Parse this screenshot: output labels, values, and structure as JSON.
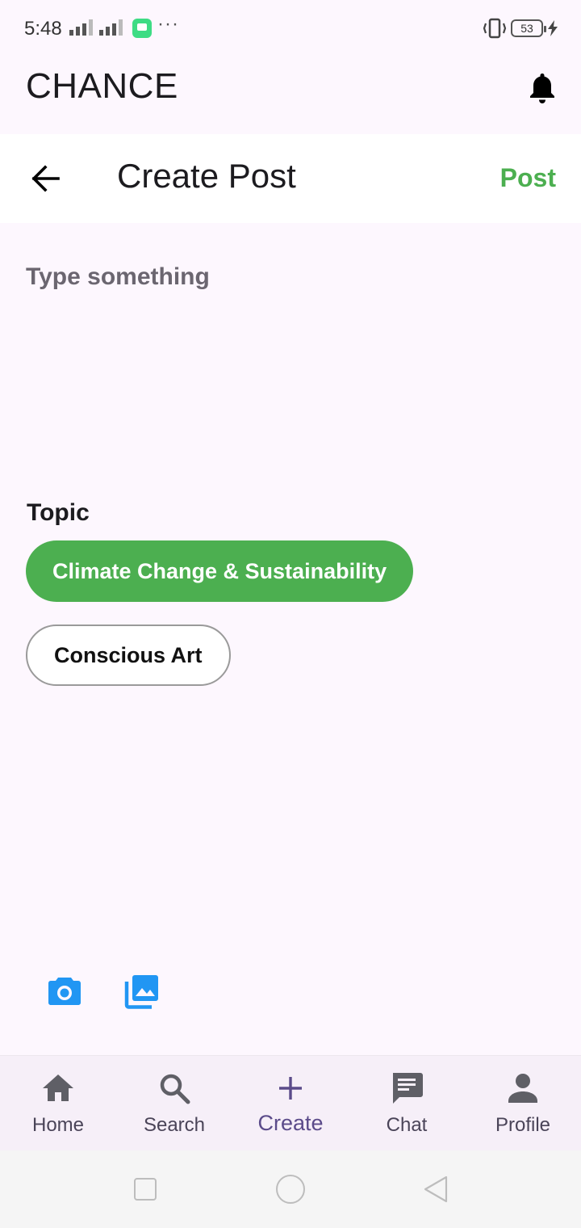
{
  "status_bar": {
    "time": "5:48",
    "battery": "53",
    "dots": "···"
  },
  "app": {
    "title": "CHANCE"
  },
  "create_post": {
    "title": "Create Post",
    "post_label": "Post",
    "input_placeholder": "Type something",
    "input_value": ""
  },
  "topic": {
    "label": "Topic",
    "chips": [
      {
        "label": "Climate Change & Sustainability",
        "selected": true
      },
      {
        "label": "Conscious Art",
        "selected": false
      }
    ]
  },
  "media": {
    "icons": [
      "camera-icon",
      "gallery-icon"
    ]
  },
  "bottom_nav": {
    "items": [
      {
        "label": "Home",
        "icon": "home-icon"
      },
      {
        "label": "Search",
        "icon": "search-icon"
      },
      {
        "label": "Create",
        "icon": "plus-icon",
        "active": true
      },
      {
        "label": "Chat",
        "icon": "chat-icon"
      },
      {
        "label": "Profile",
        "icon": "person-icon"
      }
    ]
  },
  "colors": {
    "accent_green": "#4caf50",
    "active_nav": "#5b4b8a",
    "media_blue": "#2196f3",
    "background": "#fdf7fe"
  }
}
